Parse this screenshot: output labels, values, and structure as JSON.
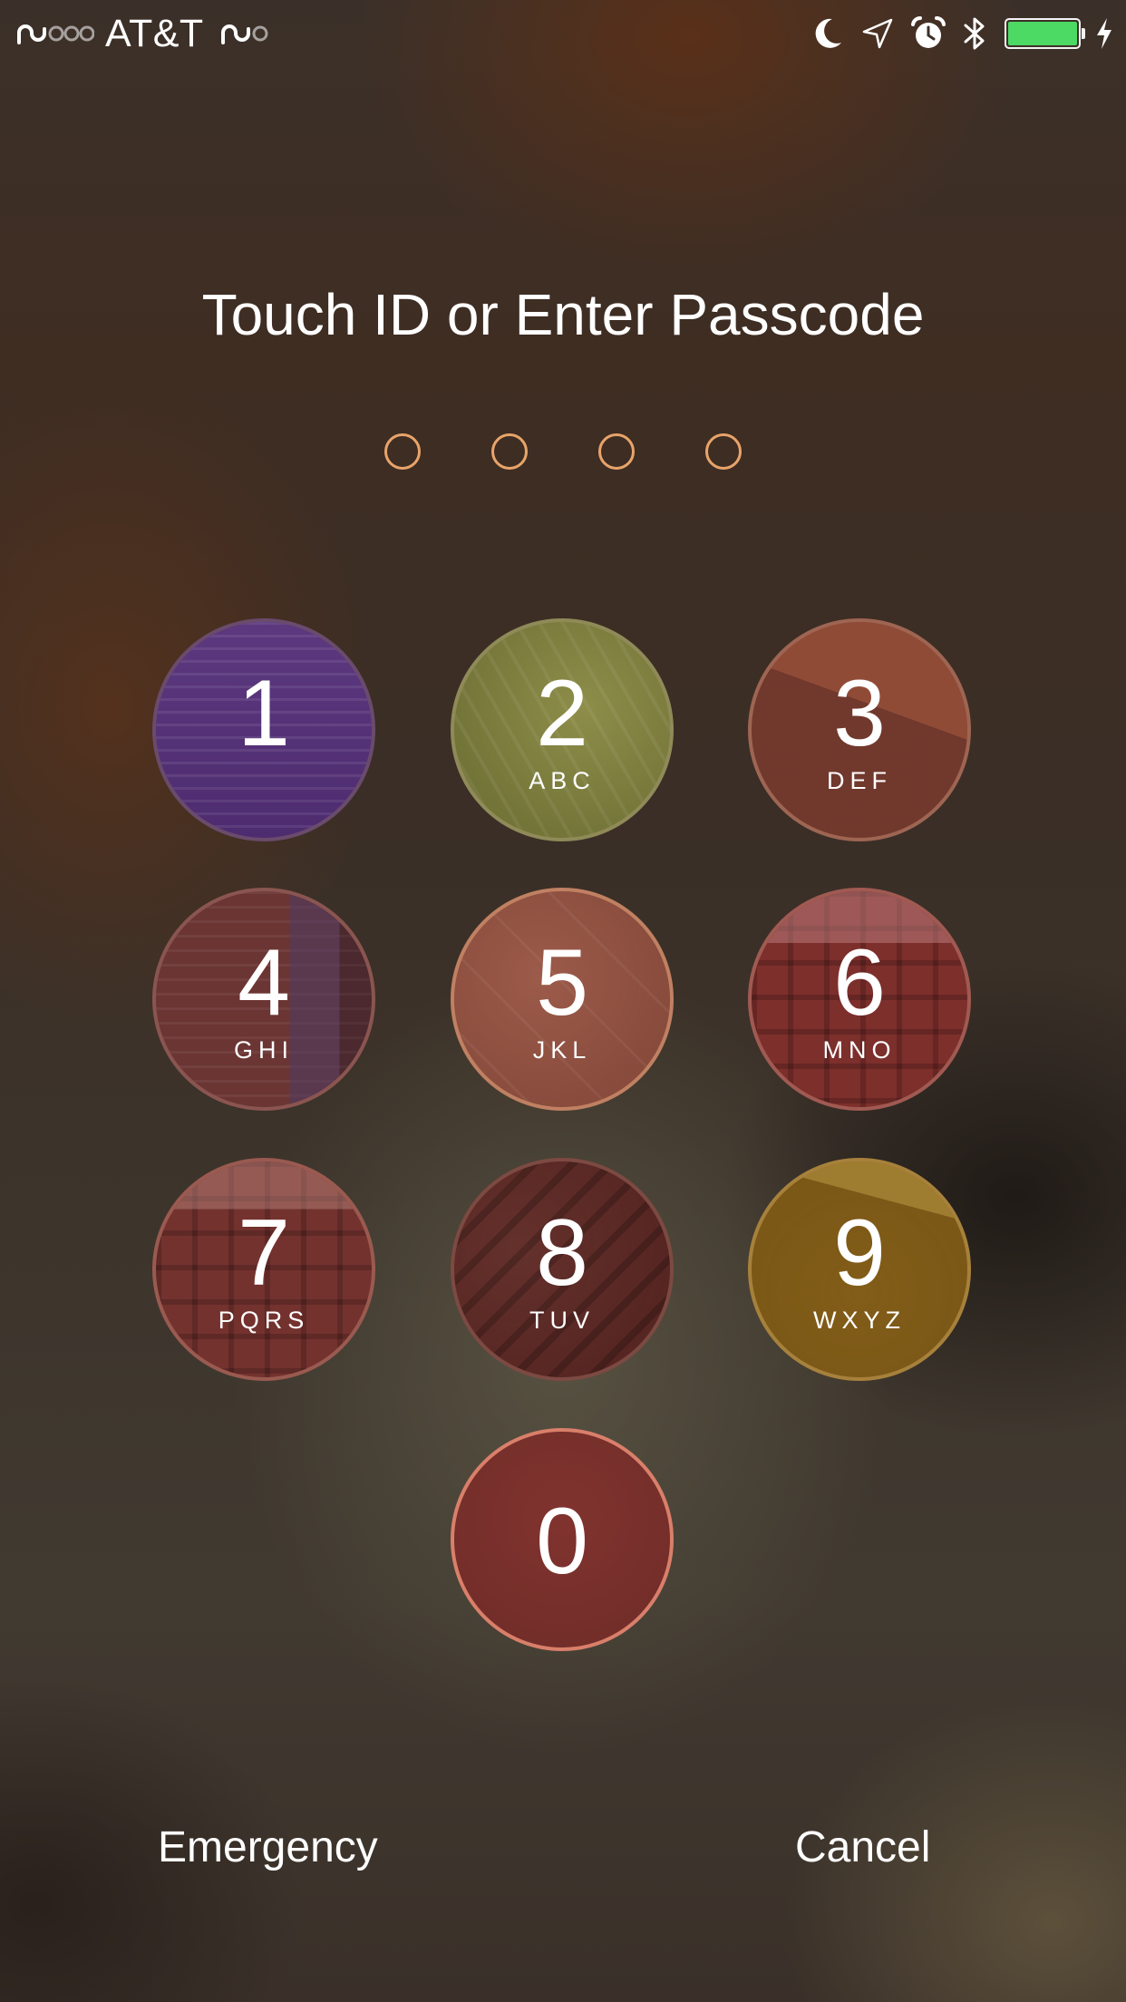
{
  "status_bar": {
    "carrier": "AT&T",
    "icons": [
      "signal-strength-icon",
      "wifi-icon",
      "moon-icon",
      "location-arrow-icon",
      "alarm-clock-icon",
      "bluetooth-icon",
      "battery-icon",
      "charging-bolt-icon"
    ],
    "battery_level": 1.0,
    "battery_color": "#4cd964"
  },
  "title": "Touch ID or Enter Passcode",
  "passcode_dots": 4,
  "dot_color": "#e8a46a",
  "keypad": [
    {
      "digit": "1",
      "letters": ""
    },
    {
      "digit": "2",
      "letters": "ABC"
    },
    {
      "digit": "3",
      "letters": "DEF"
    },
    {
      "digit": "4",
      "letters": "GHI"
    },
    {
      "digit": "5",
      "letters": "JKL"
    },
    {
      "digit": "6",
      "letters": "MNO"
    },
    {
      "digit": "7",
      "letters": "PQRS"
    },
    {
      "digit": "8",
      "letters": "TUV"
    },
    {
      "digit": "9",
      "letters": "WXYZ"
    },
    {
      "digit": "0",
      "letters": ""
    }
  ],
  "buttons": {
    "emergency": "Emergency",
    "cancel": "Cancel"
  }
}
